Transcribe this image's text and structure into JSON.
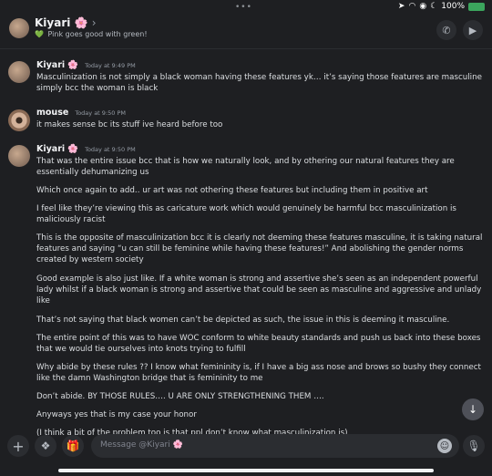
{
  "status_bar": {
    "dots": "•••",
    "battery": "100%"
  },
  "header": {
    "name": "Kiyari",
    "name_emoji": "🌸",
    "chevron": "›",
    "status_emoji": "💚",
    "status": "Pink goes good with green!",
    "call_icon": "phone-icon",
    "video_icon": "video-icon"
  },
  "messages": [
    {
      "author": "Kiyari",
      "emoji": "🌸",
      "time": "Today at 9:49 PM",
      "lines": [
        "Masculinization is not simply a black woman having these features yk… it’s saying those features are masculine simply bcc the woman is black"
      ]
    },
    {
      "author": "mouse",
      "emoji": "",
      "time": "Today at 9:50 PM",
      "lines": [
        "it makes sense bc its stuff ive heard before too"
      ]
    },
    {
      "author": "Kiyari",
      "emoji": "🌸",
      "time": "Today at 9:50 PM",
      "lines": [
        "That was the entire issue bcc that is how we naturally look, and by othering our natural features they are essentially dehumanizing us",
        "Which once again to add.. ur art was not othering these features but including them in positive art",
        "I feel like they’re viewing this as caricature work which would genuinely be harmful bcc masculinization is maliciously racist",
        "This is the opposite of masculinization bcc it is clearly not deeming these features masculine, it is taking natural features and saying “u can still be feminine while having these features!” And abolishing the gender norms created by western society",
        "Good example is also just like. If a white woman is strong and assertive she’s seen as an independent powerful lady whilst if a black woman is strong and assertive that could be seen as masculine and aggressive and unlady like",
        "That’s not saying that black women can’t be depicted as such, the issue in this is deeming it masculine.",
        "The entire point of this was to have WOC conform to white beauty standards and push us back into these boxes that we would tie ourselves into knots trying to fulfill",
        "Why abide by these rules ?? I know what femininity is, if I have a big ass nose and brows so bushy they connect like the damn Washington bridge that is femininity to me",
        "Don’t abide. BY THOSE RULES…. U ARE ONLY STRENGTHENING THEM ….",
        "Anyways yes that is my case your honor",
        "(I think a bit of the problem too is that ppl don’t know what masculinization is)"
      ]
    }
  ],
  "composer": {
    "placeholder": "Message @Kiyari 🌸",
    "plus_icon": "plus-icon",
    "apps_icon": "apps-icon",
    "gift_icon": "gift-icon",
    "emoji_icon": "emoji-icon",
    "mic_icon": "mic-icon"
  },
  "scroll_icon": "arrow-down-icon"
}
